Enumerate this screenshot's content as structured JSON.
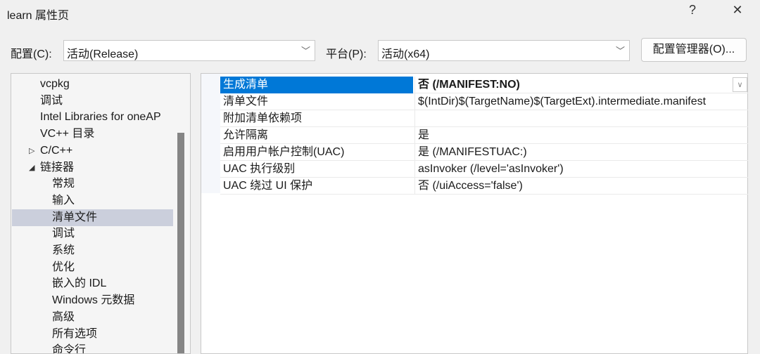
{
  "window": {
    "title": "learn 属性页",
    "help": "?",
    "close": "✕"
  },
  "toolbar": {
    "config_label": "配置(C):",
    "config_value": "活动(Release)",
    "platform_label": "平台(P):",
    "platform_value": "活动(x64)",
    "manager_button": "配置管理器(O)..."
  },
  "tree": {
    "items": [
      {
        "label": "vcpkg",
        "level": 1
      },
      {
        "label": "调试",
        "level": 1
      },
      {
        "label": "Intel Libraries for oneAP",
        "level": 1
      },
      {
        "label": "VC++ 目录",
        "level": 1
      },
      {
        "label": "C/C++",
        "level": 1,
        "toggle": "collapsed"
      },
      {
        "label": "链接器",
        "level": 1,
        "toggle": "expanded"
      },
      {
        "label": "常规",
        "level": 2
      },
      {
        "label": "输入",
        "level": 2
      },
      {
        "label": "清单文件",
        "level": 2,
        "selected": true
      },
      {
        "label": "调试",
        "level": 2
      },
      {
        "label": "系统",
        "level": 2
      },
      {
        "label": "优化",
        "level": 2
      },
      {
        "label": "嵌入的 IDL",
        "level": 2
      },
      {
        "label": "Windows 元数据",
        "level": 2
      },
      {
        "label": "高级",
        "level": 2
      },
      {
        "label": "所有选项",
        "level": 2
      },
      {
        "label": "命令行",
        "level": 2
      }
    ]
  },
  "grid": {
    "rows": [
      {
        "name": "生成清单",
        "value": "否 (/MANIFEST:NO)",
        "selected": true
      },
      {
        "name": "清单文件",
        "value": "$(IntDir)$(TargetName)$(TargetExt).intermediate.manifest"
      },
      {
        "name": "附加清单依赖项",
        "value": ""
      },
      {
        "name": "允许隔离",
        "value": "是"
      },
      {
        "name": "启用用户帐户控制(UAC)",
        "value": "是 (/MANIFESTUAC:)"
      },
      {
        "name": "UAC 执行级别",
        "value": "asInvoker (/level='asInvoker')"
      },
      {
        "name": "UAC 绕过 UI 保护",
        "value": "否 (/uiAccess='false')"
      }
    ]
  },
  "colors": {
    "selection": "#0078d7",
    "tree_selection": "#cbcfdc"
  }
}
